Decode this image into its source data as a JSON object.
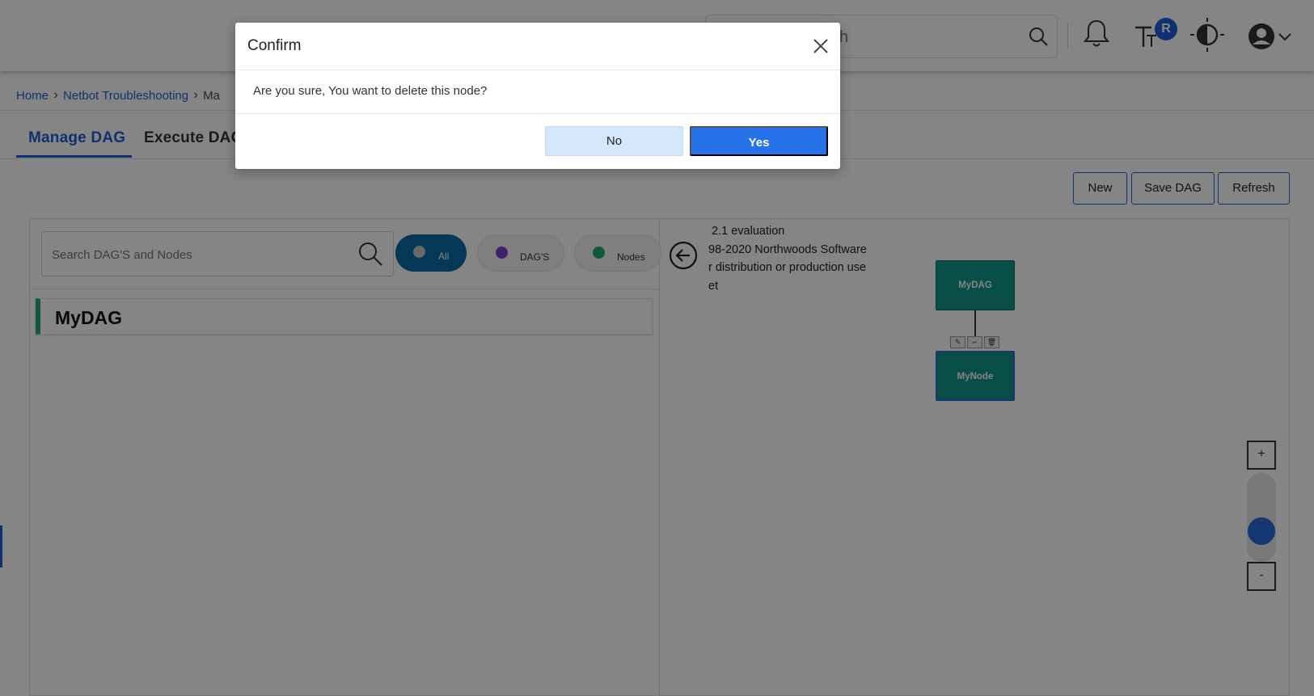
{
  "header": {
    "search_placeholder": "aracters to search",
    "notification_badge": "R"
  },
  "breadcrumb": {
    "items": [
      "Home",
      "Netbot Troubleshooting"
    ],
    "current": "Ma"
  },
  "tabs": [
    {
      "label": "Manage DAG"
    },
    {
      "label": "Execute DAG"
    }
  ],
  "actions": {
    "new_label": "New",
    "save_label": "Save DAG",
    "refresh_label": "Refresh"
  },
  "left_panel": {
    "search_placeholder": "Search DAG'S and Nodes",
    "filters": [
      {
        "label": "All",
        "dot_color": "#c9c9c9"
      },
      {
        "label": "DAG'S",
        "dot_color": "#7b3fd4"
      },
      {
        "label": "Nodes",
        "dot_color": "#1faa6e"
      }
    ],
    "items": [
      {
        "label": "MyDAG",
        "accent": "#1faa6e"
      }
    ]
  },
  "canvas": {
    "watermark": " 2.1 evaluation\n98-2020 Northwoods Software\nr distribution or production use\net",
    "nodes": [
      {
        "label": "MyDAG"
      },
      {
        "label": "MyNode"
      }
    ],
    "zoom_in": "+",
    "zoom_out": "-",
    "node_color": "#139686"
  },
  "modal": {
    "title": "Confirm",
    "message": "Are you sure, You want to delete this node?",
    "no_label": "No",
    "yes_label": "Yes"
  },
  "colors": {
    "accent": "#1f5fd6",
    "yes_button": "#2672e8",
    "no_button": "#d4e7fb"
  }
}
